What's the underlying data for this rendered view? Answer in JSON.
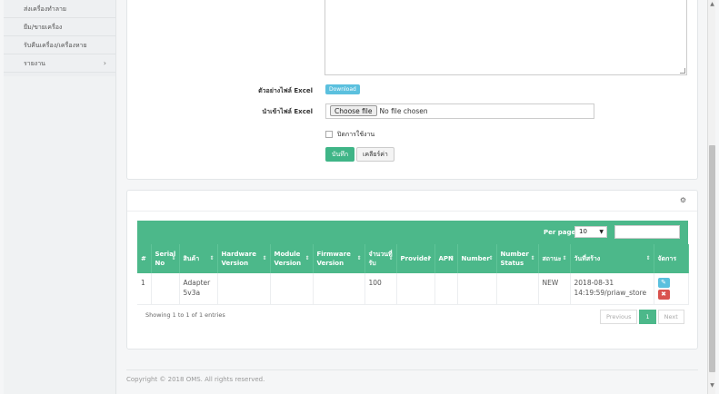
{
  "sidebar": {
    "items": [
      {
        "label": "ส่งเครื่องทำลาย"
      },
      {
        "label": "ยืม/ขายเครื่อง"
      },
      {
        "label": "รับคืนเครื่อง/เครื่องหาย"
      },
      {
        "label": "รายงาน",
        "chevron": "›"
      }
    ]
  },
  "form": {
    "sample_label": "ตัวอย่างไฟล์ Excel",
    "download_button": "Download",
    "import_label": "นำเข้าไฟล์ Excel",
    "file_button": "Choose file",
    "file_status": "No file chosen",
    "checkbox_label": "ปิดการใช้งาน",
    "save_button": "บันทึก",
    "clear_button": "เคลียร์ค่า"
  },
  "table": {
    "per_page_label": "Per page:",
    "per_page_value": "10",
    "per_page_arrow": "▼",
    "gear_icon": "⚙",
    "sort_icon": "⇕",
    "columns": [
      "#",
      "Serial No",
      "สินค้า",
      "Hardware Version",
      "Module Version",
      "Firmware Version",
      "จำนวนที่รับ",
      "Provider",
      "APN",
      "Number",
      "Number Status",
      "สถานะ",
      "วันที่สร้าง",
      "จัดการ"
    ],
    "rows": [
      {
        "no": "1",
        "serial": "",
        "product": "Adapter 5v3a",
        "hw": "",
        "module": "",
        "firmware": "",
        "qty": "100",
        "provider": "",
        "apn": "",
        "number": "",
        "number_status": "",
        "status": "NEW",
        "created": "2018-08-31 14:19:59/priaw_store",
        "edit_icon": "✎",
        "delete_icon": "✖"
      }
    ],
    "info": "Showing 1 to 1 of 1 entries",
    "pager": {
      "previous": "Previous",
      "current": "1",
      "next": "Next"
    }
  },
  "footer": {
    "text": "Copyright © 2018 OMS. All rights reserved."
  },
  "scrollbar": {
    "up": "▲",
    "down": "▼"
  },
  "colors": {
    "accent": "#4cb88a",
    "info": "#5bc0de",
    "danger": "#d9534f"
  }
}
